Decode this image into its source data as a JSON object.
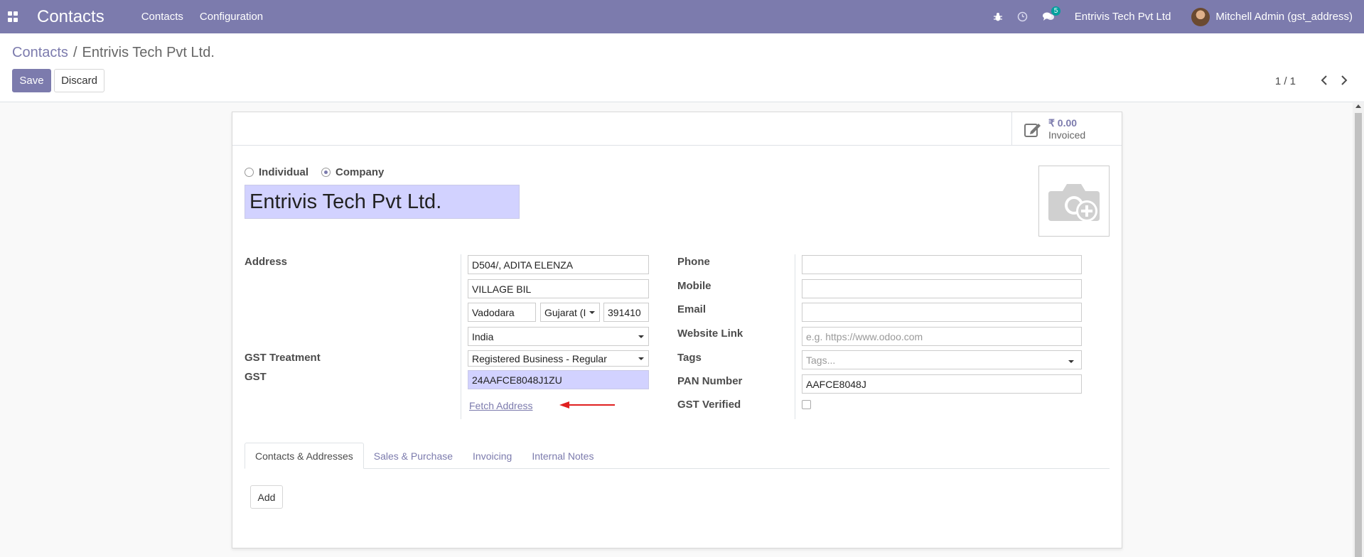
{
  "navbar": {
    "app_title": "Contacts",
    "menu": [
      "Contacts",
      "Configuration"
    ],
    "message_count": "5",
    "company": "Entrivis Tech Pvt Ltd",
    "user": "Mitchell Admin (gst_address)"
  },
  "breadcrumb": {
    "parent": "Contacts",
    "separator": "/",
    "current": "Entrivis Tech Pvt Ltd."
  },
  "actions": {
    "save": "Save",
    "discard": "Discard"
  },
  "pager": {
    "value": "1 / 1"
  },
  "stat_button": {
    "value": "₹ 0.00",
    "label": "Invoiced"
  },
  "company_type": {
    "individual": "Individual",
    "company": "Company",
    "selected": "Company"
  },
  "name": "Entrivis Tech Pvt Ltd.",
  "left_fields": {
    "address_label": "Address",
    "street": "D504/, ADITA ELENZA",
    "street2": "VILLAGE BIL",
    "city": "Vadodara",
    "state": "Gujarat (I",
    "zip": "391410",
    "country": "India",
    "gst_treatment_label": "GST Treatment",
    "gst_treatment": "Registered Business - Regular",
    "gst_label": "GST",
    "gst": "24AAFCE8048J1ZU",
    "fetch_address": "Fetch Address"
  },
  "right_fields": {
    "phone_label": "Phone",
    "phone": "",
    "mobile_label": "Mobile",
    "mobile": "",
    "email_label": "Email",
    "email": "",
    "website_label": "Website Link",
    "website_placeholder": "e.g. https://www.odoo.com",
    "tags_label": "Tags",
    "tags_placeholder": "Tags...",
    "pan_label": "PAN Number",
    "pan": "AAFCE8048J",
    "gst_verified_label": "GST Verified",
    "gst_verified": false
  },
  "tabs": [
    {
      "label": "Contacts & Addresses",
      "active": true
    },
    {
      "label": "Sales & Purchase",
      "active": false
    },
    {
      "label": "Invoicing",
      "active": false
    },
    {
      "label": "Internal Notes",
      "active": false
    }
  ],
  "tab_content": {
    "add_button": "Add"
  },
  "colors": {
    "brand": "#7c7bad",
    "required_field": "#d2d2ff",
    "annotation_arrow": "#e02020"
  }
}
